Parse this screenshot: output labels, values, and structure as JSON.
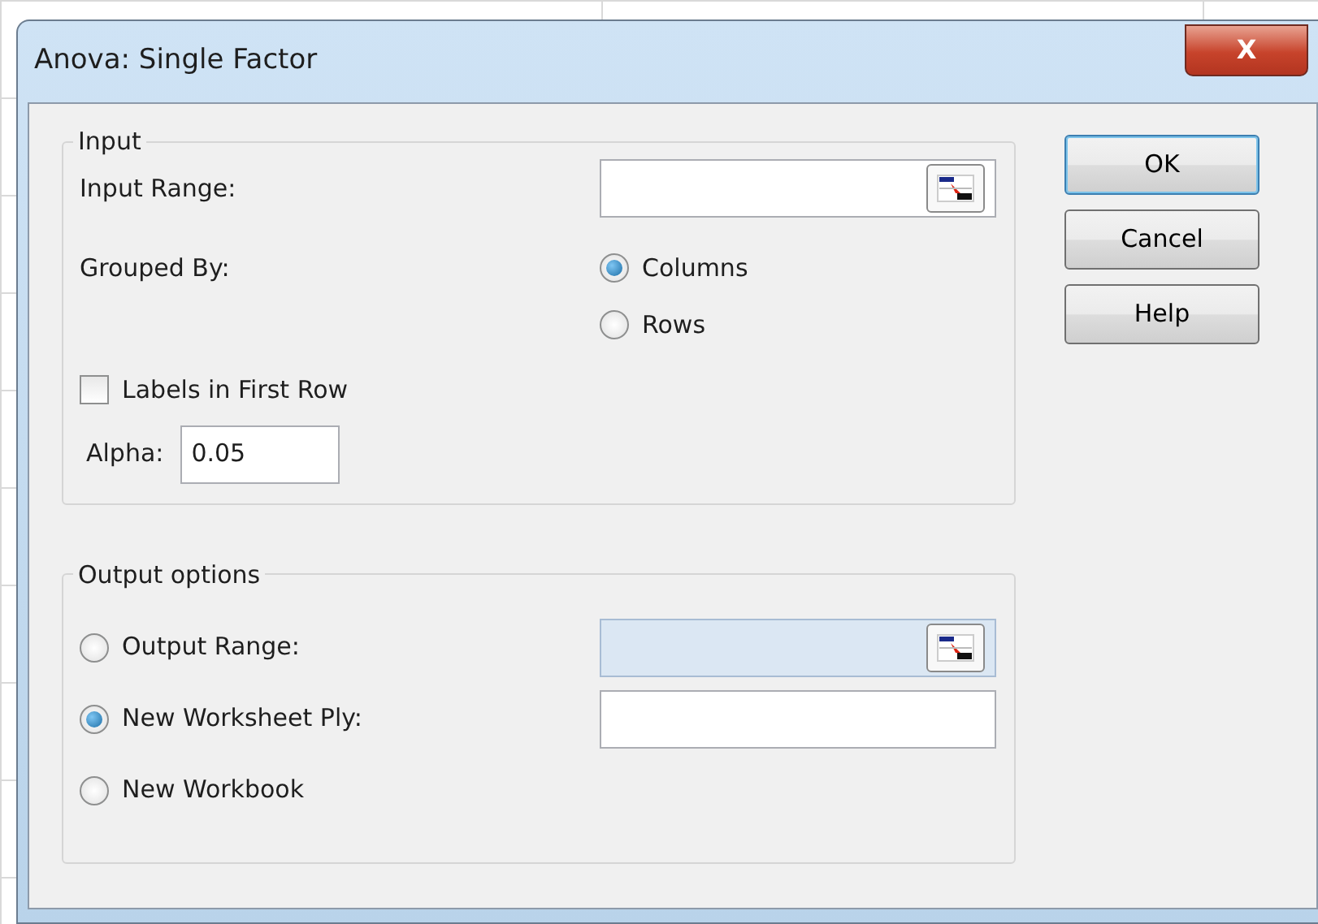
{
  "window": {
    "title": "Anova: Single Factor",
    "close_label": "X"
  },
  "input": {
    "legend": "Input",
    "input_range": {
      "label": "Input Range:"
    },
    "grouped_by": {
      "label": "Grouped By:",
      "options": [
        {
          "label": "Columns",
          "selected": true
        },
        {
          "label": "Rows",
          "selected": false
        }
      ]
    },
    "labels_in_first_row": {
      "label": "Labels in First Row",
      "checked": false
    },
    "alpha": {
      "label": "Alpha:",
      "value": "0.05"
    }
  },
  "output": {
    "legend": "Output options",
    "options": [
      {
        "label": "Output Range:",
        "selected": false,
        "field": {
          "disabled": true,
          "ref_button": true
        }
      },
      {
        "label": "New Worksheet Ply:",
        "selected": true,
        "field": {
          "disabled": false,
          "ref_button": false
        }
      },
      {
        "label": "New Workbook",
        "selected": false
      }
    ]
  },
  "buttons": [
    {
      "label": "OK",
      "default": true
    },
    {
      "label": "Cancel",
      "default": false
    },
    {
      "label": "Help",
      "default": false
    }
  ]
}
